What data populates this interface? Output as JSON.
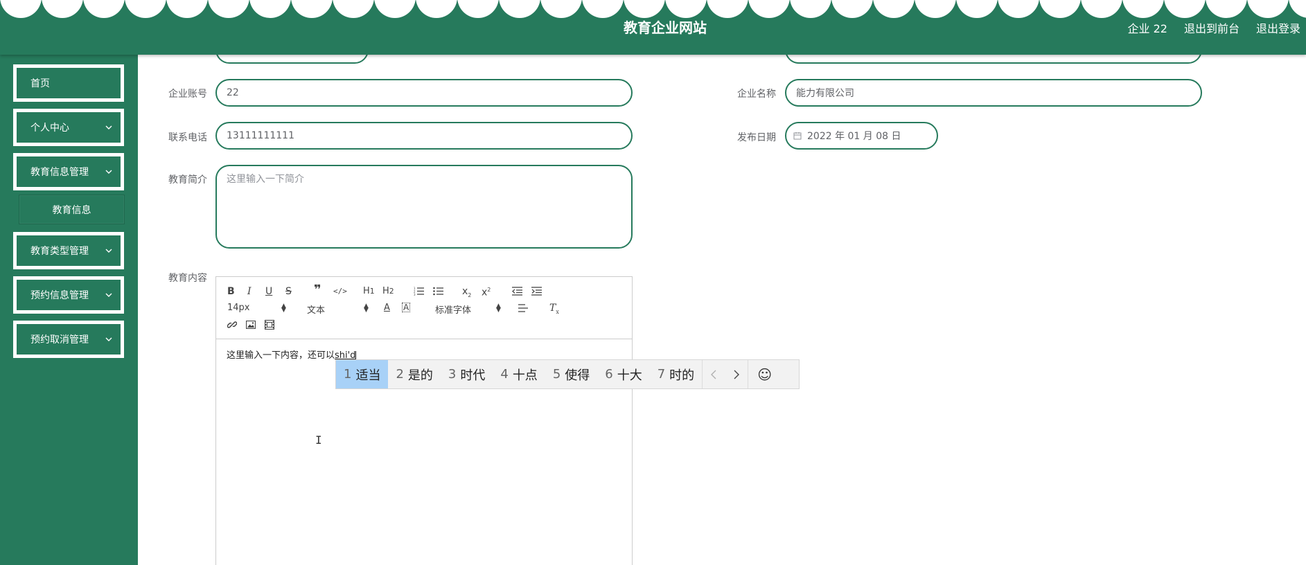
{
  "header": {
    "title": "教育企业网站",
    "user_label": "企业 22",
    "front_label": "退出到前台",
    "logout_label": "退出登录"
  },
  "sidebar": {
    "items": [
      {
        "label": "首页"
      },
      {
        "label": "个人中心"
      },
      {
        "label": "教育信息管理"
      },
      {
        "label": "教育信息"
      },
      {
        "label": "教育类型管理"
      },
      {
        "label": "预约信息管理"
      },
      {
        "label": "预约取消管理"
      }
    ]
  },
  "form": {
    "account_label": "企业账号",
    "account_value": "22",
    "company_label": "企业名称",
    "company_value": "能力有限公司",
    "phone_label": "联系电话",
    "phone_value": "13111111111",
    "date_label": "发布日期",
    "date_value": "2022 年 01 月 08 日",
    "intro_label": "教育简介",
    "intro_value": "这里输入一下简介",
    "content_label": "教育内容"
  },
  "editor": {
    "font_size": "14px",
    "text_type": "文本",
    "font_family": "标准字体",
    "content": "这里输入一下内容，还可以",
    "composition": "shi'd"
  },
  "ime": {
    "candidates": [
      {
        "num": "1",
        "text": "适当"
      },
      {
        "num": "2",
        "text": "是的"
      },
      {
        "num": "3",
        "text": "时代"
      },
      {
        "num": "4",
        "text": "十点"
      },
      {
        "num": "5",
        "text": "使得"
      },
      {
        "num": "6",
        "text": "十大"
      },
      {
        "num": "7",
        "text": "时的"
      }
    ]
  },
  "colors": {
    "brand": "#267a5c",
    "ime_highlight": "#a8d1f7"
  }
}
